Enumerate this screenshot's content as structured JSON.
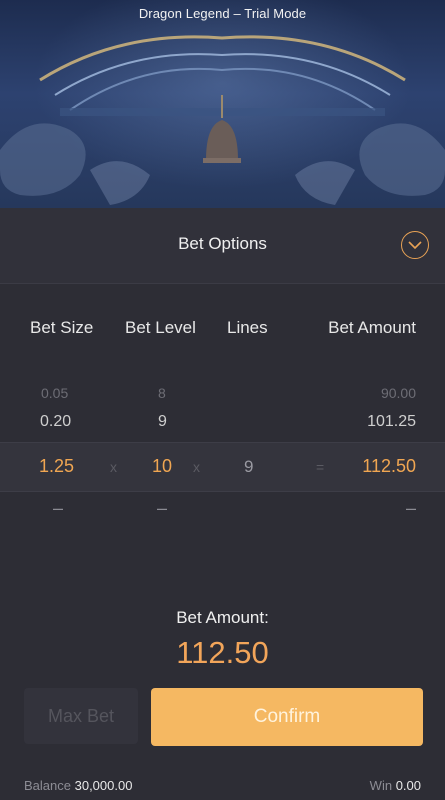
{
  "header": {
    "title": "Dragon Legend – Trial Mode"
  },
  "panel": {
    "title": "Bet Options",
    "collapse_icon": "chevron-down-icon",
    "accent": "#f0a652"
  },
  "columns": {
    "bet_size": "Bet Size",
    "bet_level": "Bet Level",
    "lines": "Lines",
    "bet_amount": "Bet Amount"
  },
  "picker": {
    "row_above_2": {
      "bet_size": "0.05",
      "bet_level": "8",
      "bet_amount": "90.00"
    },
    "row_above_1": {
      "bet_size": "0.20",
      "bet_level": "9",
      "bet_amount": "101.25"
    },
    "selected": {
      "bet_size": "1.25",
      "bet_level": "10",
      "lines": "9",
      "bet_amount": "112.50"
    },
    "row_below_1": {
      "bet_size": "–",
      "bet_level": "–",
      "bet_amount": "–"
    },
    "operators": {
      "times1": "x",
      "times2": "x",
      "equals": "="
    }
  },
  "summary": {
    "label": "Bet Amount:",
    "value": "112.50"
  },
  "buttons": {
    "max_bet": "Max Bet",
    "confirm": "Confirm"
  },
  "footer": {
    "balance_label": "Balance",
    "balance_value": "30,000.00",
    "win_label": "Win",
    "win_value": "0.00"
  }
}
